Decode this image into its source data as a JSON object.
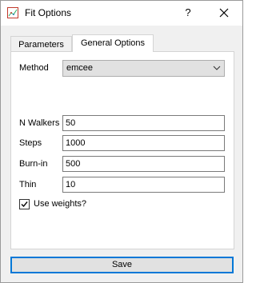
{
  "window": {
    "title": "Fit Options",
    "help_label": "?",
    "icon": "chart-icon",
    "close_icon": "close-icon"
  },
  "tabs": [
    {
      "label": "Parameters",
      "active": false
    },
    {
      "label": "General Options",
      "active": true
    }
  ],
  "form": {
    "method": {
      "label": "Method",
      "value": "emcee",
      "icon": "chevron-down-icon"
    },
    "n_walkers": {
      "label": "N Walkers",
      "value": "50"
    },
    "steps": {
      "label": "Steps",
      "value": "1000"
    },
    "burn_in": {
      "label": "Burn-in",
      "value": "500"
    },
    "thin": {
      "label": "Thin",
      "value": "10"
    },
    "use_weights": {
      "label": "Use weights?",
      "checked": true
    }
  },
  "footer": {
    "save_label": "Save"
  },
  "colors": {
    "accent": "#0078d7",
    "panel": "#ffffff",
    "window_bg": "#f0f0f0"
  }
}
